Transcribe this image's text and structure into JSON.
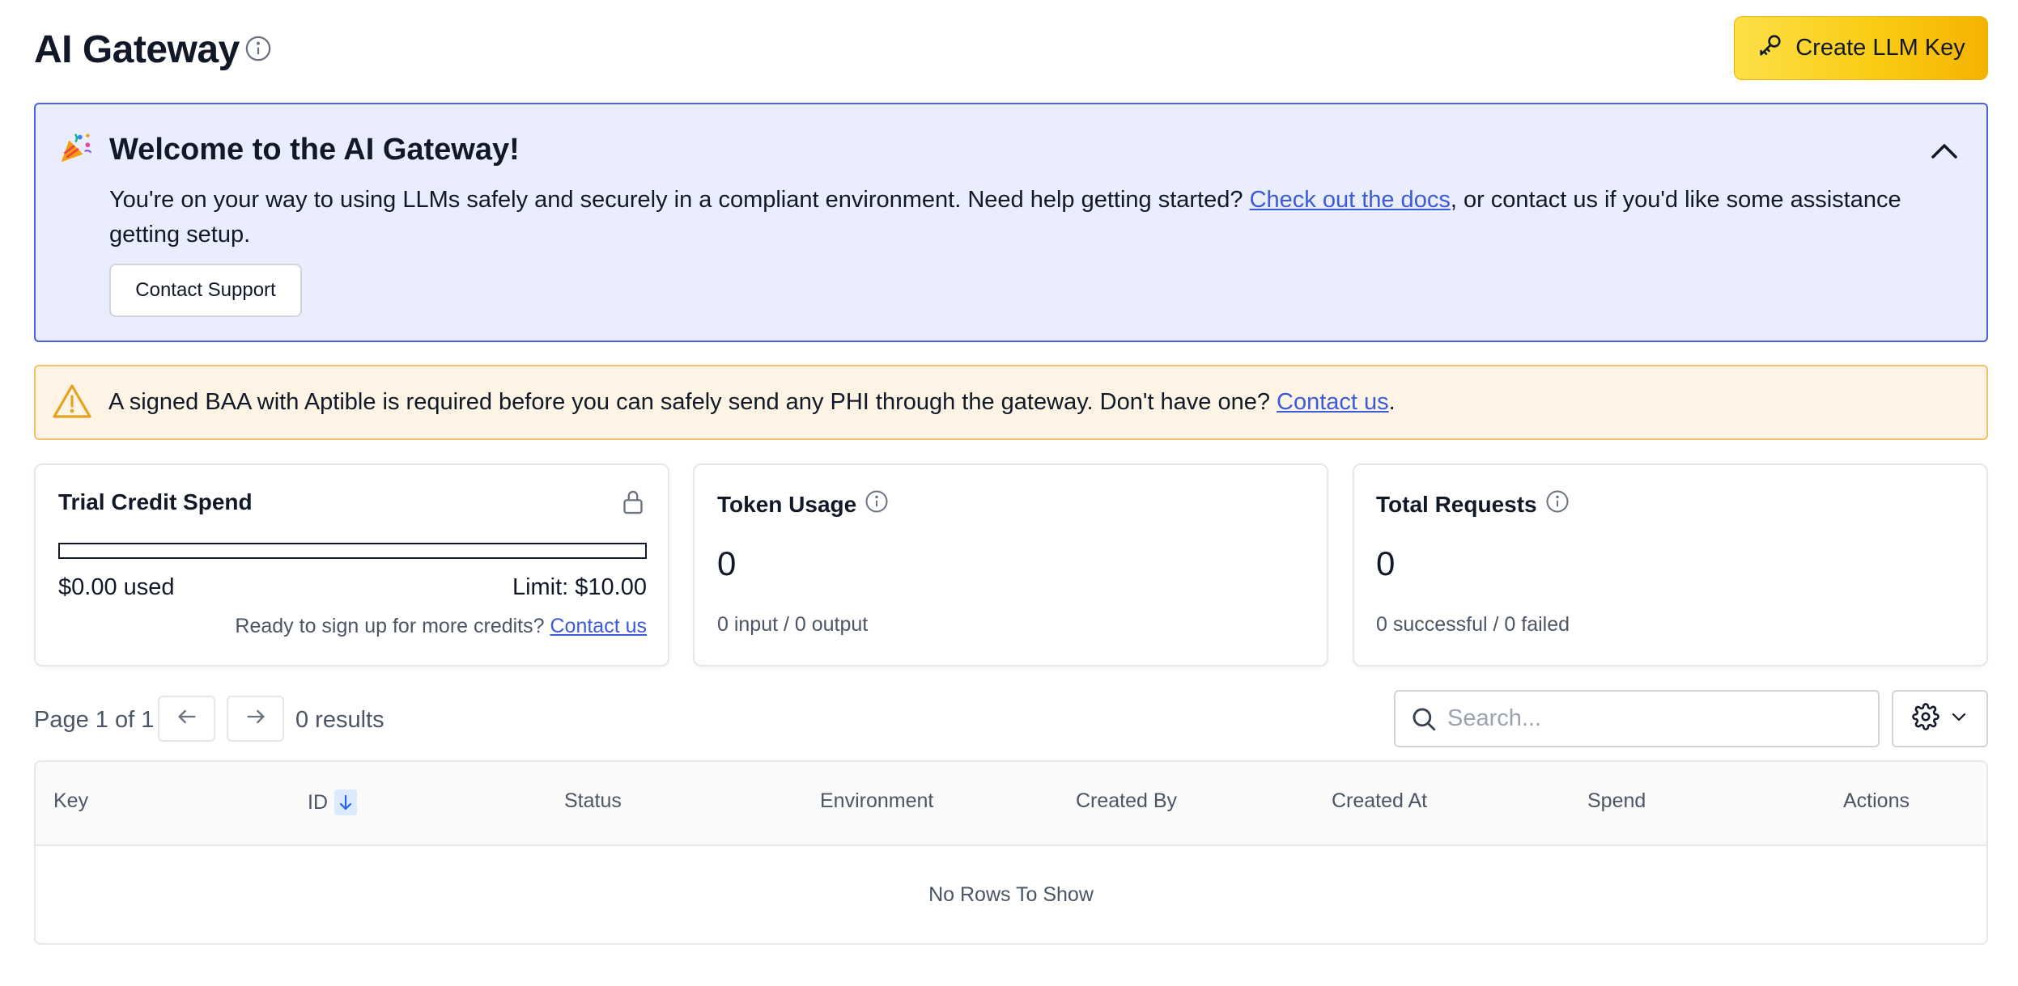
{
  "header": {
    "title": "AI Gateway",
    "create_button_label": "Create LLM Key"
  },
  "welcome": {
    "title": "Welcome to the AI Gateway!",
    "text_before_link": "You're on your way to using LLMs safely and securely in a compliant environment. Need help getting started? ",
    "docs_link": "Check out the docs",
    "text_after_link": ", or contact us if you'd like some assistance getting setup.",
    "contact_support_label": "Contact Support"
  },
  "baa_warning": {
    "text": "A signed BAA with Aptible is required before you can safely send any PHI through the gateway. Don't have one? ",
    "link": "Contact us",
    "suffix": "."
  },
  "cards": {
    "trial": {
      "title": "Trial Credit Spend",
      "used": "$0.00 used",
      "limit": "Limit: $10.00",
      "used_fraction": 0,
      "note": "Ready to sign up for more credits? ",
      "note_link": "Contact us"
    },
    "tokens": {
      "title": "Token Usage",
      "value": "0",
      "sub": "0 input / 0 output"
    },
    "requests": {
      "title": "Total Requests",
      "value": "0",
      "sub": "0 successful / 0 failed"
    }
  },
  "pagination": {
    "page_label": "Page 1 of 1",
    "results": "0 results"
  },
  "search": {
    "placeholder": "Search..."
  },
  "table": {
    "columns": [
      "Key",
      "ID",
      "Status",
      "Environment",
      "Created By",
      "Created At",
      "Spend",
      "Actions"
    ],
    "empty_message": "No Rows To Show"
  },
  "colors": {
    "accent_yellow": "#facc15",
    "link_blue": "#3b5bdb",
    "banner_border": "#4a63d8",
    "warning_border": "#f2c069"
  },
  "icons": {
    "title_info": "info-icon",
    "create": "key-icon",
    "welcome": "party-popper-icon",
    "collapse": "chevron-up-icon",
    "warning": "warning-icon",
    "trial_lock": "lock-icon",
    "prev": "arrow-left-icon",
    "next": "arrow-right-icon",
    "search": "search-icon",
    "settings": "gear-icon",
    "settings_menu": "chevron-down-icon",
    "sort": "arrow-down-icon"
  }
}
